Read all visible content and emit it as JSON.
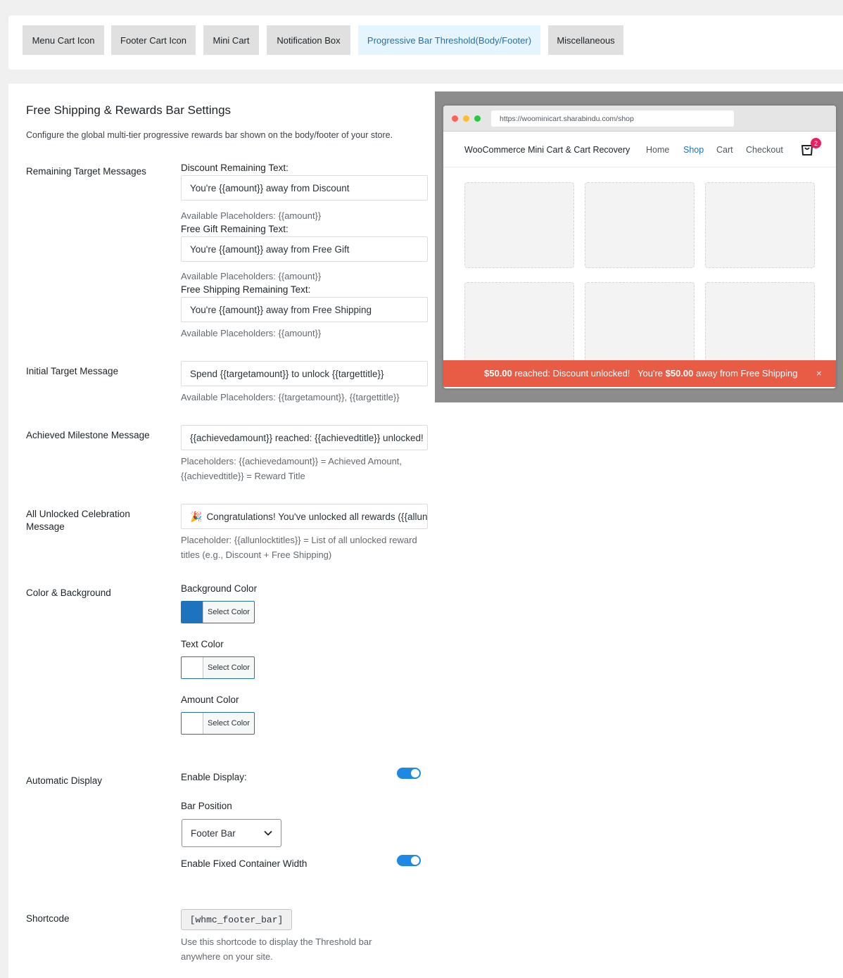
{
  "tabs": [
    {
      "label": "Menu Cart Icon"
    },
    {
      "label": "Footer Cart Icon"
    },
    {
      "label": "Mini Cart"
    },
    {
      "label": "Notification Box"
    },
    {
      "label": "Progressive Bar Threshold(Body/Footer)",
      "active": true
    },
    {
      "label": "Miscellaneous"
    }
  ],
  "header": {
    "title": "Free Shipping & Rewards Bar Settings",
    "description": "Configure the global multi-tier progressive rewards bar shown on the body/footer of your store."
  },
  "remaining": {
    "label": "Remaining Target Messages",
    "discount_label": "Discount Remaining Text:",
    "discount_value": "You're {{amount}} away from Discount",
    "discount_help": "Available Placeholders: {{amount}}",
    "gift_label": "Free Gift Remaining Text:",
    "gift_value": "You're {{amount}} away from Free Gift",
    "gift_help": "Available Placeholders: {{amount}}",
    "shipping_label": "Free Shipping Remaining Text:",
    "shipping_value": "You're {{amount}} away from Free Shipping",
    "shipping_help": "Available Placeholders: {{amount}}"
  },
  "initial": {
    "label": "Initial Target Message",
    "value": "Spend {{targetamount}} to unlock {{targettitle}}",
    "help": "Available Placeholders: {{targetamount}}, {{targettitle}}"
  },
  "achieved": {
    "label": "Achieved Milestone Message",
    "value": "{{achievedamount}} reached: {{achievedtitle}} unlocked!",
    "help": "Placeholders: {{achievedamount}} = Achieved Amount, {{achievedtitle}} = Reward Title"
  },
  "celebration": {
    "label": "All Unlocked Celebration Message",
    "icon": "party-popper",
    "value": "Congratulations! You've unlocked all rewards ({{allunlocktitles}})",
    "help": "Placeholder: {{allunlocktitles}} = List of all unlocked reward titles (e.g., Discount + Free Shipping)"
  },
  "colors": {
    "label": "Color & Background",
    "select_text": "Select Color",
    "background_label": "Background Color",
    "background_value": "#1e73be",
    "text_label": "Text Color",
    "text_value": "#ffffff",
    "amount_label": "Amount Color",
    "amount_value": "#ffffff"
  },
  "display": {
    "label": "Automatic Display",
    "enable_label": "Enable Display:",
    "enable_on": true,
    "position_label": "Bar Position",
    "position_value": "Footer Bar",
    "fixed_label": "Enable Fixed Container Width",
    "fixed_on": true
  },
  "shortcode": {
    "label": "Shortcode",
    "code": "[whmc_footer_bar]",
    "help": "Use this shortcode to display the Threshold bar anywhere on your site."
  },
  "preview": {
    "url": "https://woominicart.sharabindu.com/shop",
    "brand": "WooCommerce Mini Cart & Cart Recovery",
    "nav": [
      "Home",
      "Shop",
      "Cart",
      "Checkout"
    ],
    "active_nav": "Shop",
    "cart_count": "2",
    "notice_amount1": "$50.00",
    "notice_text1": " reached: Discount unlocked!   You're ",
    "notice_amount2": "$50.00",
    "notice_text2": " away from Free Shipping",
    "notice_close": "×",
    "notice_color": "#e85c45"
  }
}
